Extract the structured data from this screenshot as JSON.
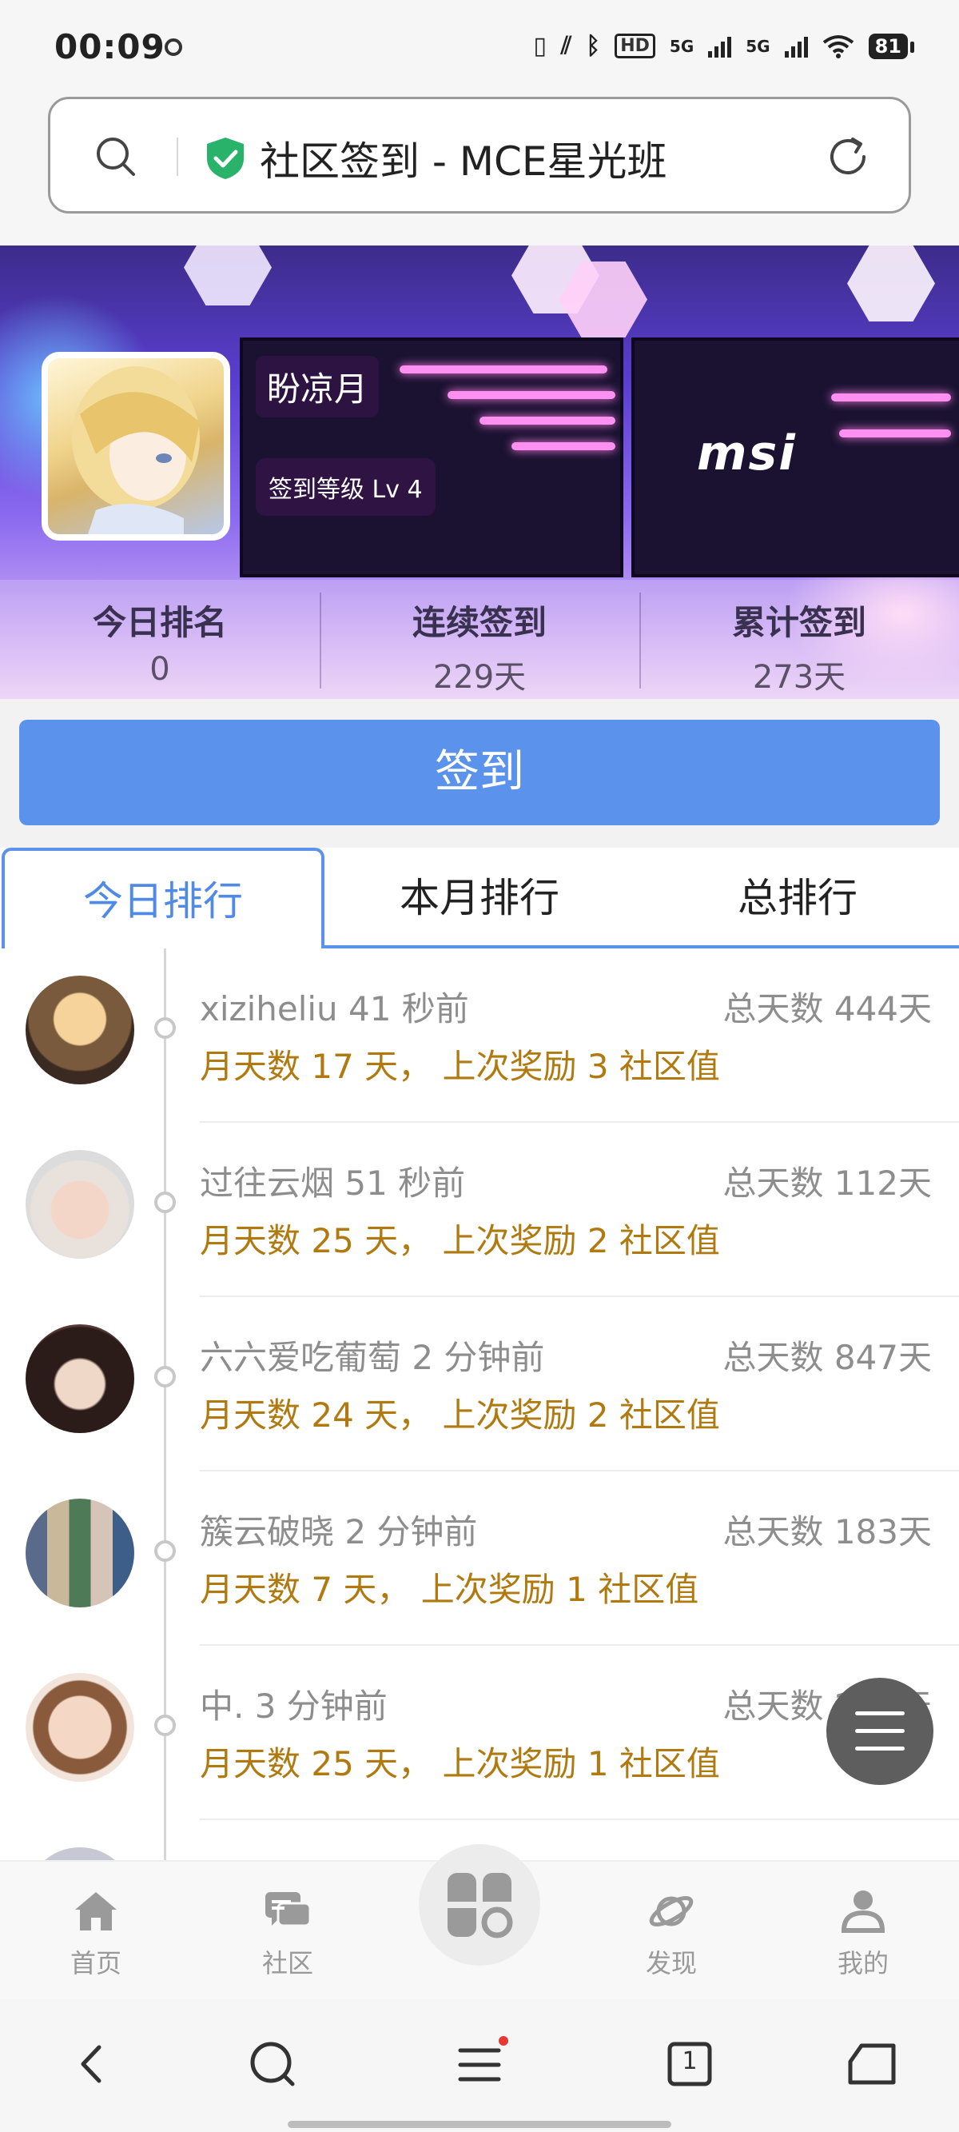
{
  "status_bar": {
    "time": "00:09",
    "battery": "81",
    "hd_label": "HD",
    "net_5g": "5G"
  },
  "address_bar": {
    "title": "社区签到 - MCE星光班"
  },
  "profile": {
    "name": "盼凉月",
    "level": "签到等级 Lv 4",
    "banner_brand": "msi",
    "stats": [
      {
        "label": "今日排名",
        "value": "0"
      },
      {
        "label": "连续签到",
        "value": "229天"
      },
      {
        "label": "累计签到",
        "value": "273天"
      }
    ]
  },
  "sign_button": "签到",
  "tabs": [
    {
      "label": "今日排行",
      "active": true
    },
    {
      "label": "本月排行",
      "active": false
    },
    {
      "label": "总排行",
      "active": false
    }
  ],
  "rankings": [
    {
      "name_time": "xiziheliu 41 秒前",
      "total": "总天数 444天",
      "detail": "月天数 17 天， 上次奖励 3 社区值"
    },
    {
      "name_time": "过往云烟 51 秒前",
      "total": "总天数 112天",
      "detail": "月天数 25 天， 上次奖励 2 社区值"
    },
    {
      "name_time": "六六爱吃葡萄 2 分钟前",
      "total": "总天数 847天",
      "detail": "月天数 24 天， 上次奖励 2 社区值"
    },
    {
      "name_time": "簇云破晓 2 分钟前",
      "total": "总天数 183天",
      "detail": "月天数 7 天， 上次奖励 1 社区值"
    },
    {
      "name_time": "中. 3 分钟前",
      "total": "总天数 250天",
      "detail": "月天数 25 天， 上次奖励 1 社区值"
    }
  ],
  "bottom_nav": [
    {
      "label": "首页",
      "icon": "home-icon"
    },
    {
      "label": "社区",
      "icon": "chat-icon"
    },
    {
      "label": "",
      "icon": "apps-icon"
    },
    {
      "label": "发现",
      "icon": "planet-icon"
    },
    {
      "label": "我的",
      "icon": "user-icon"
    }
  ],
  "browser_bar": {
    "tab_count": "1"
  },
  "colors": {
    "accent": "#5b93ec",
    "gold_text": "#b07a10",
    "muted_text": "#8d8d8d"
  }
}
